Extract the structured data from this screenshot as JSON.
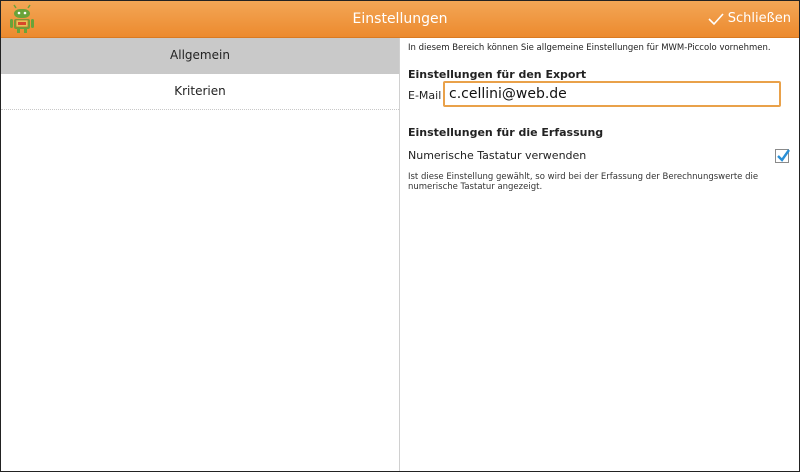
{
  "header": {
    "title": "Einstellungen",
    "close_label": "Schließen"
  },
  "sidebar": {
    "items": [
      {
        "label": "Allgemein",
        "active": true
      },
      {
        "label": "Kriterien",
        "active": false
      }
    ]
  },
  "content": {
    "intro": "In diesem Bereich können Sie allgemeine Einstellungen für MWM-Piccolo vornehmen.",
    "export_heading": "Einstellungen für den Export",
    "email_label": "E-Mail",
    "email_value": "c.cellini@web.de",
    "capture_heading": "Einstellungen für die Erfassung",
    "numeric_keyboard_label": "Numerische Tastatur verwenden",
    "numeric_keyboard_checked": true,
    "numeric_keyboard_desc": "Ist diese Einstellung gewählt, so wird bei der Erfassung der Berechnungswerte die numerische Tastatur angezeigt."
  },
  "colors": {
    "accent": "#ec8a2e",
    "active_item": "#c9c9c9",
    "checkmark": "#2a8fd6"
  },
  "icons": {
    "app": "android-robot-icon",
    "close": "checkmark-icon"
  }
}
